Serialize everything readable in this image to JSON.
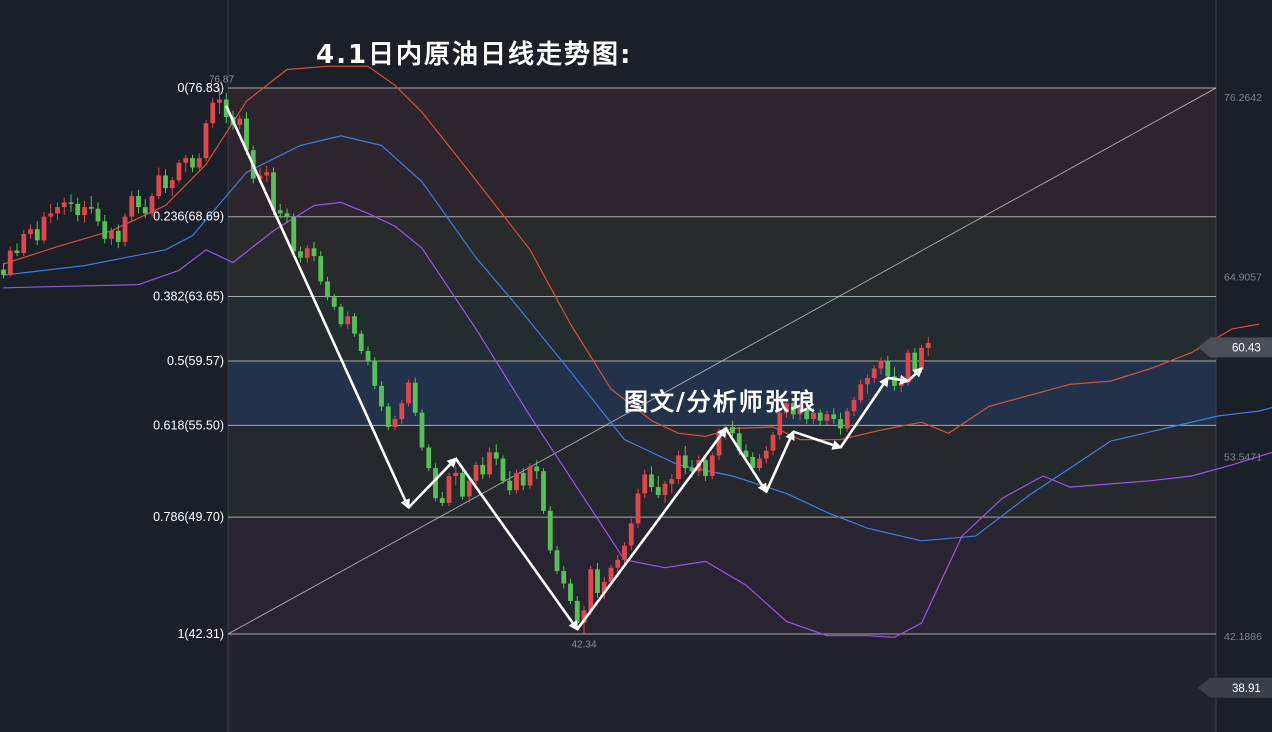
{
  "title": "4.1日内原油日线走势图:",
  "watermark": "图文/分析师张琅",
  "colors": {
    "background": "#1b1f27",
    "up_candle": "#e0474c",
    "down_candle": "#56c256",
    "upper_band": "#d9513a",
    "middle_band": "#3e7de0",
    "lower_band": "#9a55e8",
    "arrow": "#ffffff",
    "fib_line": "#c8c8c8"
  },
  "chart_data": {
    "type": "candlestick",
    "title": "4.1日内原油日线走势图:",
    "indicators": [
      "fibonacci-retracement",
      "bollinger-bands"
    ],
    "fibonacci_levels": [
      {
        "ratio": "0",
        "price": 76.83,
        "label": "0(76.83)"
      },
      {
        "ratio": "0.236",
        "price": 68.69,
        "label": "0.236(68.69)"
      },
      {
        "ratio": "0.382",
        "price": 63.65,
        "label": "0.382(63.65)"
      },
      {
        "ratio": "0.5",
        "price": 59.57,
        "label": "0.5(59.57)"
      },
      {
        "ratio": "0.618",
        "price": 55.5,
        "label": "0.618(55.50)"
      },
      {
        "ratio": "0.786",
        "price": 49.7,
        "label": "0.786(49.70)"
      },
      {
        "ratio": "1",
        "price": 42.31,
        "label": "1(42.31)"
      }
    ],
    "price_axis_labels": [
      "76.2642",
      "64.9057",
      "53.5471",
      "42.1886"
    ],
    "current_price": "60.43",
    "lower_badge": "38.91",
    "swing_high": "76.87",
    "swing_low": "42.34",
    "ylim": [
      37.5,
      77.5
    ],
    "candles": [
      [
        65.35,
        65.75,
        64.8,
        65.0
      ],
      [
        65.0,
        66.8,
        64.9,
        66.55
      ],
      [
        66.55,
        67.0,
        66.2,
        66.4
      ],
      [
        66.4,
        67.85,
        66.2,
        67.6
      ],
      [
        67.6,
        68.2,
        67.3,
        67.9
      ],
      [
        67.9,
        68.4,
        66.9,
        67.2
      ],
      [
        67.2,
        69.0,
        67.0,
        68.7
      ],
      [
        68.7,
        69.5,
        68.3,
        68.9
      ],
      [
        68.9,
        69.6,
        68.5,
        69.3
      ],
      [
        69.3,
        69.9,
        68.8,
        69.6
      ],
      [
        69.6,
        70.1,
        69.0,
        69.5
      ],
      [
        69.5,
        69.9,
        68.4,
        68.8
      ],
      [
        68.8,
        69.7,
        68.3,
        69.3
      ],
      [
        69.3,
        70.0,
        68.9,
        69.2
      ],
      [
        69.2,
        69.6,
        68.1,
        68.4
      ],
      [
        68.4,
        68.8,
        67.0,
        67.3
      ],
      [
        67.3,
        68.0,
        66.9,
        67.8
      ],
      [
        67.8,
        68.2,
        66.7,
        67.1
      ],
      [
        67.1,
        68.9,
        66.8,
        68.7
      ],
      [
        68.7,
        70.3,
        68.4,
        70.0
      ],
      [
        70.0,
        70.4,
        68.9,
        69.3
      ],
      [
        69.3,
        69.8,
        68.6,
        68.9
      ],
      [
        68.9,
        70.2,
        68.7,
        70.0
      ],
      [
        70.0,
        71.8,
        69.8,
        71.3
      ],
      [
        71.3,
        71.7,
        70.2,
        70.5
      ],
      [
        70.5,
        71.2,
        70.0,
        71.0
      ],
      [
        71.0,
        72.3,
        70.8,
        72.1
      ],
      [
        72.1,
        72.6,
        71.5,
        72.4
      ],
      [
        72.4,
        72.6,
        71.5,
        71.8
      ],
      [
        71.8,
        72.7,
        71.6,
        72.4
      ],
      [
        72.4,
        74.8,
        72.2,
        74.6
      ],
      [
        74.6,
        76.2,
        74.3,
        75.9
      ],
      [
        75.9,
        76.87,
        75.2,
        76.1
      ],
      [
        76.1,
        76.5,
        74.6,
        75.0
      ],
      [
        75.0,
        75.4,
        74.2,
        74.5
      ],
      [
        74.5,
        75.1,
        74.2,
        74.9
      ],
      [
        74.9,
        75.3,
        72.6,
        72.9
      ],
      [
        72.9,
        73.2,
        70.8,
        71.1
      ],
      [
        71.1,
        71.8,
        70.8,
        71.3
      ],
      [
        71.3,
        71.9,
        70.9,
        71.5
      ],
      [
        71.5,
        71.8,
        68.8,
        69.1
      ],
      [
        69.1,
        69.5,
        68.6,
        68.9
      ],
      [
        68.9,
        69.2,
        68.3,
        68.7
      ],
      [
        68.7,
        68.9,
        66.3,
        66.5
      ],
      [
        66.5,
        66.8,
        65.8,
        66.1
      ],
      [
        66.1,
        66.9,
        65.8,
        66.7
      ],
      [
        66.7,
        67.1,
        65.9,
        66.2
      ],
      [
        66.2,
        66.5,
        64.4,
        64.6
      ],
      [
        64.6,
        64.9,
        63.4,
        63.6
      ],
      [
        63.6,
        63.8,
        62.8,
        63.0
      ],
      [
        63.0,
        63.2,
        61.7,
        61.9
      ],
      [
        61.9,
        62.7,
        61.6,
        62.4
      ],
      [
        62.4,
        62.6,
        61.1,
        61.3
      ],
      [
        61.3,
        61.5,
        60.0,
        60.2
      ],
      [
        60.2,
        60.5,
        59.3,
        59.6
      ],
      [
        59.6,
        59.8,
        57.8,
        58.0
      ],
      [
        58.0,
        58.3,
        56.4,
        56.7
      ],
      [
        56.7,
        56.9,
        55.2,
        55.4
      ],
      [
        55.4,
        56.1,
        55.2,
        55.9
      ],
      [
        55.9,
        57.1,
        55.6,
        56.9
      ],
      [
        56.9,
        58.4,
        56.7,
        58.2
      ],
      [
        58.2,
        58.5,
        56.1,
        56.3
      ],
      [
        56.3,
        56.5,
        53.9,
        54.1
      ],
      [
        54.1,
        54.3,
        52.6,
        52.8
      ],
      [
        52.8,
        53.1,
        50.7,
        50.9
      ],
      [
        50.9,
        51.3,
        50.4,
        50.6
      ],
      [
        50.6,
        52.5,
        50.4,
        52.3
      ],
      [
        52.3,
        52.9,
        51.7,
        52.5
      ],
      [
        52.5,
        52.8,
        50.8,
        51.0
      ],
      [
        51.0,
        52.3,
        50.6,
        52.0
      ],
      [
        52.0,
        53.2,
        51.6,
        53.0
      ],
      [
        53.0,
        53.5,
        52.1,
        52.4
      ],
      [
        52.4,
        54.1,
        52.2,
        53.8
      ],
      [
        53.8,
        54.3,
        53.0,
        53.4
      ],
      [
        53.4,
        53.6,
        51.8,
        52.0
      ],
      [
        52.0,
        52.6,
        51.1,
        51.4
      ],
      [
        51.4,
        52.7,
        51.2,
        52.5
      ],
      [
        52.5,
        52.8,
        51.4,
        51.7
      ],
      [
        51.7,
        53.1,
        51.5,
        52.9
      ],
      [
        52.9,
        53.3,
        52.1,
        52.6
      ],
      [
        52.6,
        52.8,
        49.9,
        50.1
      ],
      [
        50.1,
        50.4,
        47.4,
        47.6
      ],
      [
        47.6,
        47.9,
        46.1,
        46.3
      ],
      [
        46.3,
        46.6,
        45.2,
        45.5
      ],
      [
        45.5,
        45.8,
        44.2,
        44.4
      ],
      [
        44.4,
        44.7,
        42.8,
        43.0
      ],
      [
        43.0,
        44.1,
        42.34,
        43.8
      ],
      [
        43.8,
        46.6,
        43.5,
        46.4
      ],
      [
        46.4,
        46.8,
        44.6,
        44.9
      ],
      [
        44.9,
        45.9,
        44.5,
        45.6
      ],
      [
        45.6,
        46.7,
        45.3,
        46.5
      ],
      [
        46.5,
        47.3,
        45.9,
        47.0
      ],
      [
        47.0,
        48.1,
        46.7,
        47.9
      ],
      [
        47.9,
        49.6,
        47.6,
        49.3
      ],
      [
        49.3,
        51.5,
        49.0,
        51.2
      ],
      [
        51.2,
        52.7,
        50.9,
        52.4
      ],
      [
        52.4,
        52.9,
        51.3,
        51.6
      ],
      [
        51.6,
        52.3,
        50.9,
        51.1
      ],
      [
        51.1,
        52.0,
        50.6,
        51.8
      ],
      [
        51.8,
        52.4,
        51.2,
        52.1
      ],
      [
        52.1,
        53.9,
        51.8,
        53.6
      ],
      [
        53.6,
        54.2,
        52.4,
        52.8
      ],
      [
        52.8,
        53.3,
        52.2,
        52.6
      ],
      [
        52.6,
        53.6,
        52.3,
        53.3
      ],
      [
        53.3,
        53.6,
        52.0,
        52.3
      ],
      [
        52.3,
        53.8,
        52.1,
        53.6
      ],
      [
        53.6,
        55.3,
        53.3,
        55.1
      ],
      [
        55.1,
        55.6,
        54.6,
        55.4
      ],
      [
        55.4,
        55.8,
        54.8,
        55.0
      ],
      [
        55.0,
        55.4,
        53.6,
        53.9
      ],
      [
        53.9,
        54.3,
        53.2,
        53.5
      ],
      [
        53.5,
        53.8,
        52.5,
        52.8
      ],
      [
        52.8,
        53.7,
        52.6,
        53.4
      ],
      [
        53.4,
        54.2,
        53.1,
        53.9
      ],
      [
        53.9,
        55.1,
        53.6,
        54.9
      ],
      [
        54.9,
        56.6,
        54.6,
        56.3
      ],
      [
        56.3,
        57.2,
        56.0,
        56.9
      ],
      [
        56.9,
        57.1,
        55.9,
        56.2
      ],
      [
        56.2,
        56.9,
        55.8,
        56.6
      ],
      [
        56.6,
        56.9,
        55.6,
        55.9
      ],
      [
        55.9,
        56.6,
        55.6,
        56.3
      ],
      [
        56.3,
        56.5,
        55.5,
        55.8
      ],
      [
        55.8,
        56.4,
        55.5,
        56.2
      ],
      [
        56.2,
        56.6,
        55.6,
        55.9
      ],
      [
        55.9,
        56.3,
        54.9,
        55.3
      ],
      [
        55.3,
        56.6,
        55.1,
        56.4
      ],
      [
        56.4,
        57.3,
        56.1,
        57.1
      ],
      [
        57.1,
        58.4,
        56.9,
        58.1
      ],
      [
        58.1,
        58.7,
        57.5,
        58.5
      ],
      [
        58.5,
        59.3,
        58.2,
        59.1
      ],
      [
        59.1,
        59.8,
        58.7,
        59.6
      ],
      [
        59.6,
        59.9,
        58.4,
        58.6
      ],
      [
        58.6,
        59.2,
        57.7,
        58.0
      ],
      [
        58.0,
        58.4,
        57.6,
        58.2
      ],
      [
        58.2,
        60.3,
        58.0,
        60.1
      ],
      [
        60.1,
        60.4,
        58.7,
        59.0
      ],
      [
        59.0,
        60.6,
        58.8,
        60.4
      ],
      [
        60.4,
        61.1,
        59.9,
        60.7
      ]
    ],
    "bands": {
      "upper": [
        [
          0,
          65.7
        ],
        [
          8,
          66.8
        ],
        [
          16,
          67.8
        ],
        [
          24,
          69.4
        ],
        [
          30,
          72.0
        ],
        [
          36,
          76.0
        ],
        [
          42,
          78.0
        ],
        [
          48,
          78.2
        ],
        [
          54,
          78.2
        ],
        [
          58,
          77.0
        ],
        [
          62,
          75.3
        ],
        [
          70,
          71.0
        ],
        [
          78,
          66.6
        ],
        [
          84,
          61.9
        ],
        [
          90,
          57.8
        ],
        [
          96,
          55.8
        ],
        [
          100,
          55.0
        ],
        [
          104,
          54.8
        ],
        [
          108,
          55.3
        ],
        [
          114,
          55.4
        ],
        [
          118,
          54.6
        ],
        [
          124,
          54.6
        ],
        [
          130,
          55.2
        ],
        [
          136,
          55.7
        ],
        [
          140,
          55.0
        ],
        [
          146,
          56.7
        ],
        [
          152,
          57.4
        ],
        [
          158,
          58.1
        ],
        [
          164,
          58.3
        ],
        [
          170,
          59.1
        ],
        [
          176,
          60.1
        ],
        [
          182,
          61.6
        ],
        [
          186,
          61.9
        ]
      ],
      "middle": [
        [
          0,
          65.0
        ],
        [
          12,
          65.6
        ],
        [
          24,
          66.6
        ],
        [
          28,
          67.5
        ],
        [
          36,
          71.5
        ],
        [
          44,
          73.2
        ],
        [
          50,
          73.8
        ],
        [
          56,
          73.2
        ],
        [
          62,
          70.9
        ],
        [
          70,
          66.1
        ],
        [
          76,
          63.1
        ],
        [
          84,
          58.9
        ],
        [
          92,
          54.6
        ],
        [
          100,
          53.0
        ],
        [
          108,
          52.3
        ],
        [
          116,
          51.2
        ],
        [
          122,
          50.0
        ],
        [
          128,
          49.0
        ],
        [
          136,
          48.2
        ],
        [
          144,
          48.5
        ],
        [
          152,
          51.1
        ],
        [
          158,
          52.8
        ],
        [
          164,
          54.5
        ],
        [
          172,
          55.3
        ],
        [
          180,
          56.1
        ],
        [
          186,
          56.4
        ],
        [
          192,
          57.1
        ],
        [
          198,
          58.0
        ],
        [
          204,
          58.4
        ],
        [
          210,
          59.3
        ],
        [
          216,
          60.4
        ],
        [
          220,
          60.7
        ]
      ],
      "lower": [
        [
          0,
          64.2
        ],
        [
          10,
          64.3
        ],
        [
          20,
          64.4
        ],
        [
          26,
          65.3
        ],
        [
          30,
          66.6
        ],
        [
          34,
          65.8
        ],
        [
          40,
          67.8
        ],
        [
          46,
          69.4
        ],
        [
          50,
          69.6
        ],
        [
          54,
          68.9
        ],
        [
          58,
          68.1
        ],
        [
          62,
          66.7
        ],
        [
          70,
          61.6
        ],
        [
          78,
          56.1
        ],
        [
          86,
          50.9
        ],
        [
          92,
          47.0
        ],
        [
          98,
          46.5
        ],
        [
          104,
          46.9
        ],
        [
          110,
          45.4
        ],
        [
          116,
          43.1
        ],
        [
          122,
          42.2
        ],
        [
          128,
          42.2
        ],
        [
          132,
          42.1
        ],
        [
          136,
          43.0
        ],
        [
          142,
          48.5
        ],
        [
          148,
          50.9
        ],
        [
          154,
          52.3
        ],
        [
          158,
          51.6
        ],
        [
          164,
          51.8
        ],
        [
          170,
          52.0
        ],
        [
          176,
          52.3
        ],
        [
          182,
          53.0
        ],
        [
          188,
          53.8
        ],
        [
          196,
          54.6
        ],
        [
          204,
          55.0
        ],
        [
          212,
          55.4
        ],
        [
          220,
          55.8
        ]
      ]
    },
    "trend_arrows": [
      [
        33,
        75.7
      ],
      [
        60,
        50.3
      ],
      [
        67,
        53.4
      ],
      [
        85,
        42.6
      ],
      [
        107,
        55.3
      ],
      [
        113,
        51.3
      ],
      [
        117,
        55.1
      ],
      [
        124,
        54.1
      ],
      [
        131,
        58.5
      ],
      [
        134,
        58.3
      ],
      [
        136,
        59.1
      ]
    ]
  }
}
